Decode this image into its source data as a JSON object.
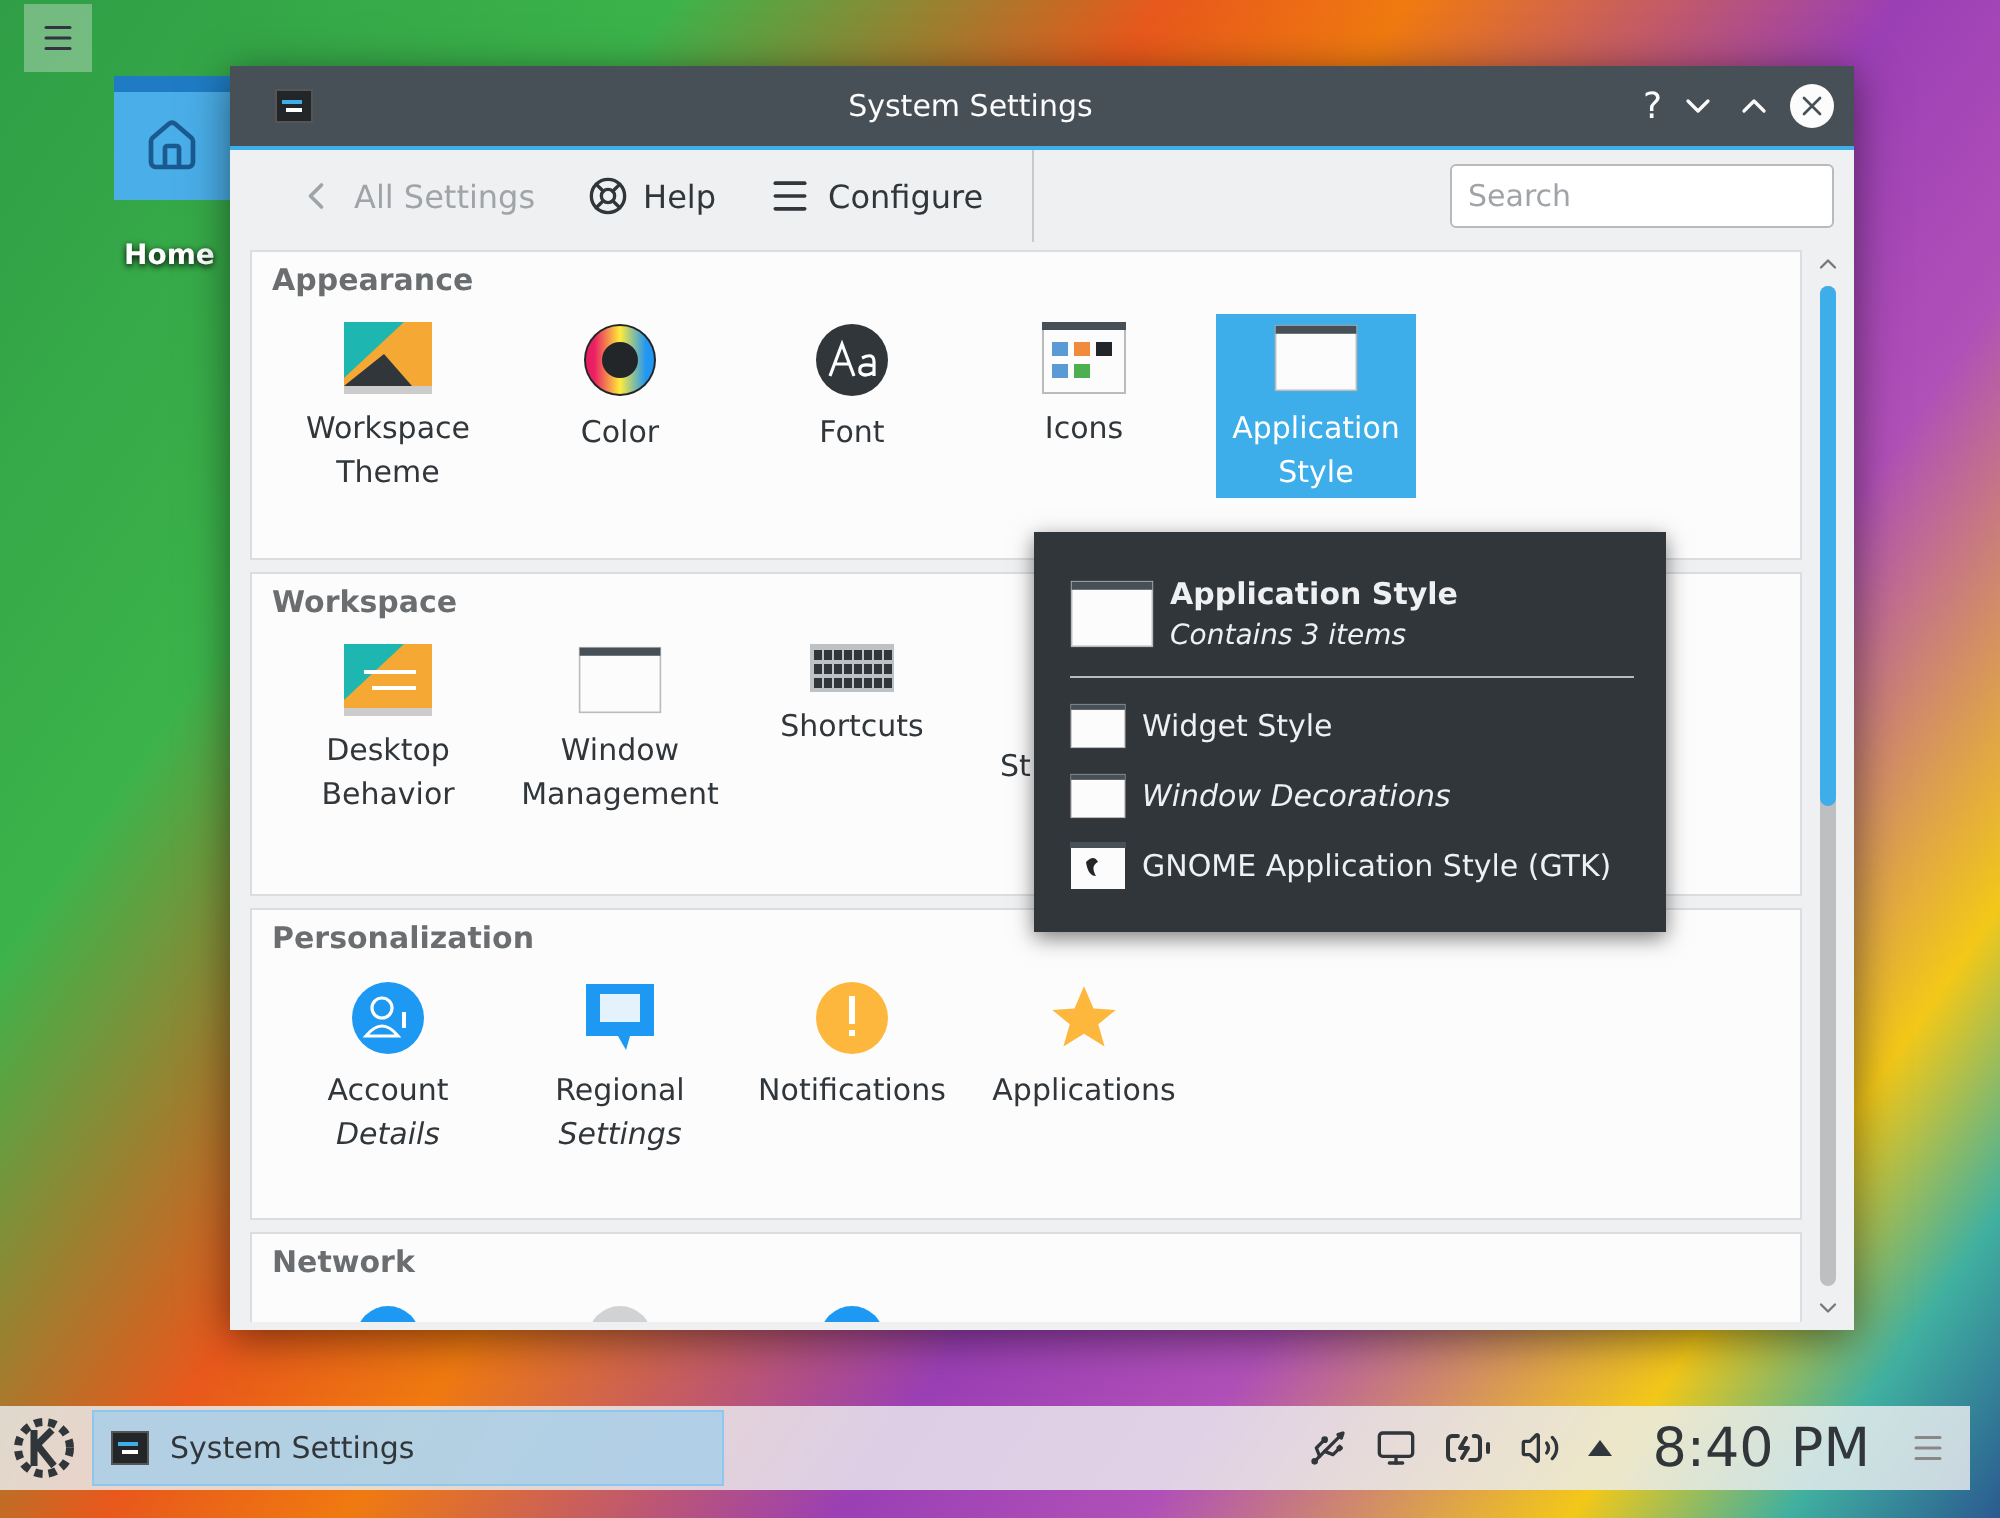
{
  "desktop": {
    "icons": [
      {
        "label": "Home"
      }
    ]
  },
  "window": {
    "title": "System Settings",
    "help_button": "?",
    "toolbar": {
      "back": "All Settings",
      "help": "Help",
      "configure": "Configure"
    },
    "search": {
      "placeholder": "Search"
    },
    "sections": [
      {
        "title": "Appearance",
        "items": [
          {
            "label": "Workspace Theme",
            "kind": "theme",
            "selected": false
          },
          {
            "label": "Color",
            "kind": "color",
            "selected": false
          },
          {
            "label": "Font",
            "kind": "font",
            "selected": false
          },
          {
            "label": "Icons",
            "kind": "icons",
            "selected": false
          },
          {
            "label": "Application Style",
            "kind": "window",
            "selected": true
          }
        ]
      },
      {
        "title": "Workspace",
        "items": [
          {
            "label": "Desktop Behavior",
            "kind": "desktop",
            "selected": false
          },
          {
            "label": "Window Management",
            "kind": "window",
            "selected": false
          },
          {
            "label": "Shortcuts",
            "kind": "keyboard",
            "selected": false
          },
          {
            "label": "St",
            "kind": "cut",
            "selected": false
          }
        ]
      },
      {
        "title": "Personalization",
        "items": [
          {
            "label": "Account *Details*",
            "kind": "account",
            "selected": false
          },
          {
            "label": "Regional *Settings*",
            "kind": "regional",
            "selected": false
          },
          {
            "label": "Notifications",
            "kind": "notify",
            "selected": false
          },
          {
            "label": "Applications",
            "kind": "star",
            "selected": false
          }
        ]
      },
      {
        "title": "Network",
        "items": [
          {
            "kind": "globe",
            "selected": false
          },
          {
            "kind": "disc",
            "selected": false
          },
          {
            "kind": "dot",
            "selected": false
          }
        ]
      }
    ]
  },
  "popup": {
    "title": "Application Style",
    "subtitle": "Contains 3 items",
    "items": [
      {
        "label": "Widget Style",
        "kind": "window",
        "italic": false
      },
      {
        "label": "Window Decorations",
        "kind": "window",
        "italic": true
      },
      {
        "label": "GNOME Application Style (GTK)",
        "kind": "gtk",
        "italic": false
      }
    ]
  },
  "taskbar": {
    "task": {
      "label": "System Settings",
      "selected": true
    },
    "clock": "8:40 PM"
  }
}
